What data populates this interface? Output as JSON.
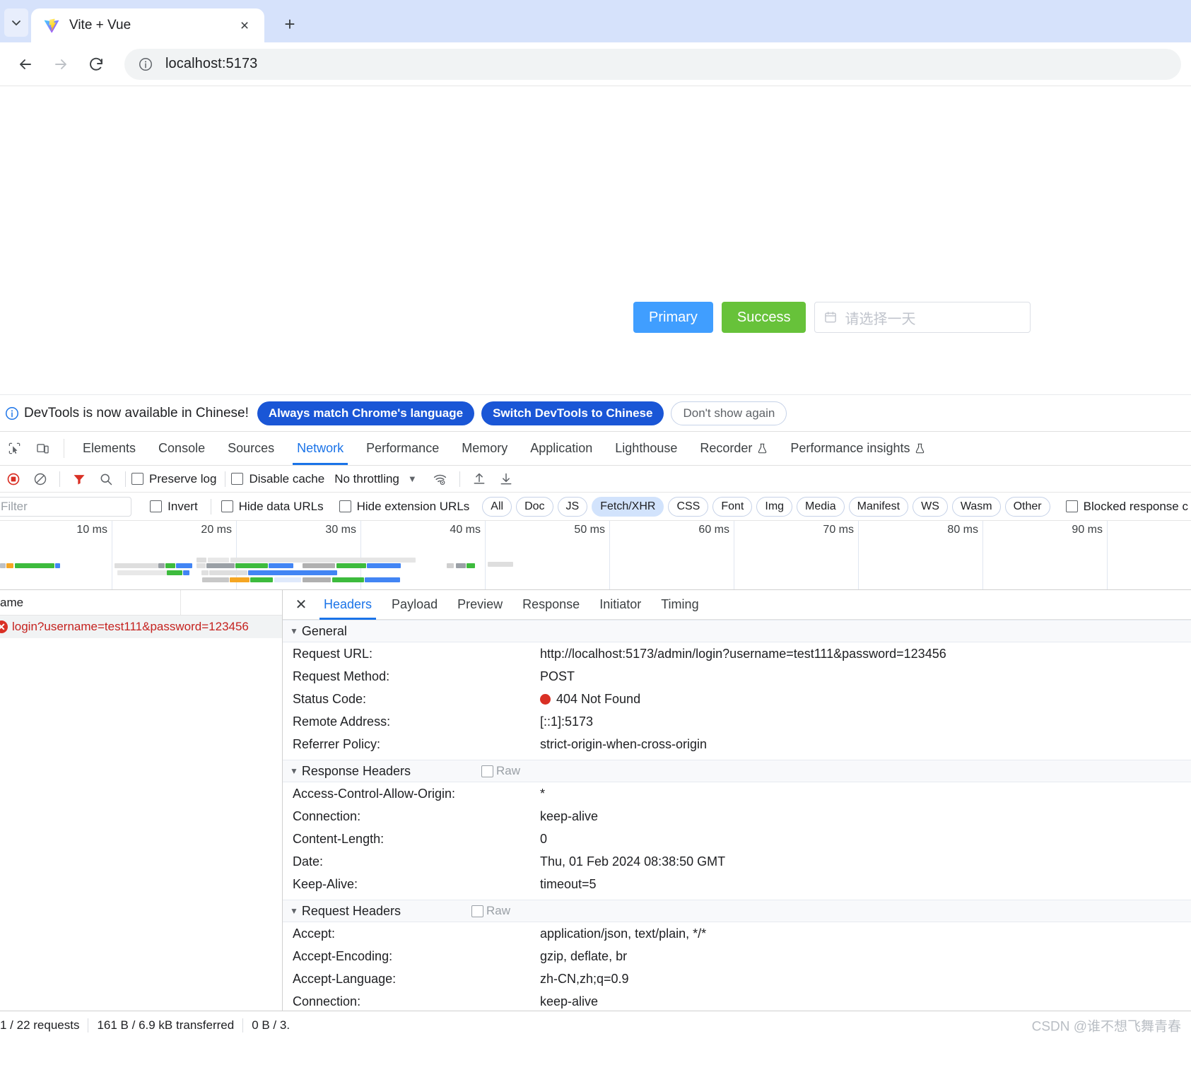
{
  "browser": {
    "tab": {
      "title": "Vite + Vue",
      "favicon": "vite-logo-icon",
      "close": "×"
    },
    "new_tab": "+",
    "tab_search": "chevron-down-icon",
    "nav": {
      "back": "←",
      "forward": "→",
      "reload": "⟳"
    },
    "omnibox": {
      "info_icon": "info-circle-icon",
      "url": "localhost:5173"
    }
  },
  "page": {
    "primary_button": "Primary",
    "success_button": "Success",
    "date_picker": {
      "icon": "calendar-icon",
      "placeholder": "请选择一天"
    }
  },
  "devtools": {
    "infobar": {
      "icon": "info-circle-icon",
      "message": "DevTools is now available in Chinese!",
      "buttons": [
        {
          "label": "Always match Chrome's language",
          "style": "filled"
        },
        {
          "label": "Switch DevTools to Chinese",
          "style": "filled"
        },
        {
          "label": "Don't show again",
          "style": "outline"
        }
      ]
    },
    "tabs": [
      {
        "label": "Elements",
        "active": false,
        "flask": false
      },
      {
        "label": "Console",
        "active": false,
        "flask": false
      },
      {
        "label": "Sources",
        "active": false,
        "flask": false
      },
      {
        "label": "Network",
        "active": true,
        "flask": false
      },
      {
        "label": "Performance",
        "active": false,
        "flask": false
      },
      {
        "label": "Memory",
        "active": false,
        "flask": false
      },
      {
        "label": "Application",
        "active": false,
        "flask": false
      },
      {
        "label": "Lighthouse",
        "active": false,
        "flask": false
      },
      {
        "label": "Recorder",
        "active": false,
        "flask": true
      },
      {
        "label": "Performance insights",
        "active": false,
        "flask": true
      }
    ],
    "toolbar": {
      "record_icon": "record-stop-icon",
      "clear_icon": "clear-icon",
      "filter_icon": "filter-funnel-icon",
      "search_icon": "search-icon",
      "preserve_log": "Preserve log",
      "disable_cache": "Disable cache",
      "throttling": "No throttling",
      "throttle_caret": "▼",
      "network_conditions_icon": "wifi-settings-icon",
      "import_icon": "import-har-icon",
      "export_icon": "export-har-icon"
    },
    "filterbar": {
      "filter_placeholder": "Filter",
      "invert": "Invert",
      "hide_data_urls": "Hide data URLs",
      "hide_extension_urls": "Hide extension URLs",
      "types": [
        "All",
        "Doc",
        "JS",
        "Fetch/XHR",
        "CSS",
        "Font",
        "Img",
        "Media",
        "Manifest",
        "WS",
        "Wasm",
        "Other"
      ],
      "active_type": "Fetch/XHR",
      "blocked_responses": "Blocked response c"
    },
    "overview": {
      "tick_labels": [
        "10 ms",
        "20 ms",
        "30 ms",
        "40 ms",
        "50 ms",
        "60 ms",
        "70 ms",
        "80 ms",
        "90 ms"
      ]
    },
    "request_list": {
      "column_header": "ame",
      "rows": [
        {
          "name": "login?username=test111&password=123456",
          "status": "error"
        }
      ]
    },
    "detail": {
      "close": "✕",
      "tabs": [
        {
          "label": "Headers",
          "active": true
        },
        {
          "label": "Payload",
          "active": false
        },
        {
          "label": "Preview",
          "active": false
        },
        {
          "label": "Response",
          "active": false
        },
        {
          "label": "Initiator",
          "active": false
        },
        {
          "label": "Timing",
          "active": false
        }
      ],
      "sections": [
        {
          "title": "General",
          "raw": null,
          "rows": [
            {
              "key": "Request URL:",
              "value": "http://localhost:5173/admin/login?username=test111&password=123456"
            },
            {
              "key": "Request Method:",
              "value": "POST"
            },
            {
              "key": "Status Code:",
              "value": "404 Not Found",
              "dot": "red"
            },
            {
              "key": "Remote Address:",
              "value": "[::1]:5173"
            },
            {
              "key": "Referrer Policy:",
              "value": "strict-origin-when-cross-origin"
            }
          ]
        },
        {
          "title": "Response Headers",
          "raw": "Raw",
          "rows": [
            {
              "key": "Access-Control-Allow-Origin:",
              "value": "*"
            },
            {
              "key": "Connection:",
              "value": "keep-alive"
            },
            {
              "key": "Content-Length:",
              "value": "0"
            },
            {
              "key": "Date:",
              "value": "Thu, 01 Feb 2024 08:38:50 GMT"
            },
            {
              "key": "Keep-Alive:",
              "value": "timeout=5"
            }
          ]
        },
        {
          "title": "Request Headers",
          "raw": "Raw",
          "rows": [
            {
              "key": "Accept:",
              "value": "application/json, text/plain, */*"
            },
            {
              "key": "Accept-Encoding:",
              "value": "gzip, deflate, br"
            },
            {
              "key": "Accept-Language:",
              "value": "zh-CN,zh;q=0.9"
            },
            {
              "key": "Connection:",
              "value": "keep-alive"
            }
          ]
        }
      ]
    },
    "status_bar": {
      "requests": "1 / 22 requests",
      "transferred": "161 B / 6.9 kB transferred",
      "resources": "0 B / 3."
    },
    "watermark": "CSDN @谁不想飞舞青春"
  }
}
